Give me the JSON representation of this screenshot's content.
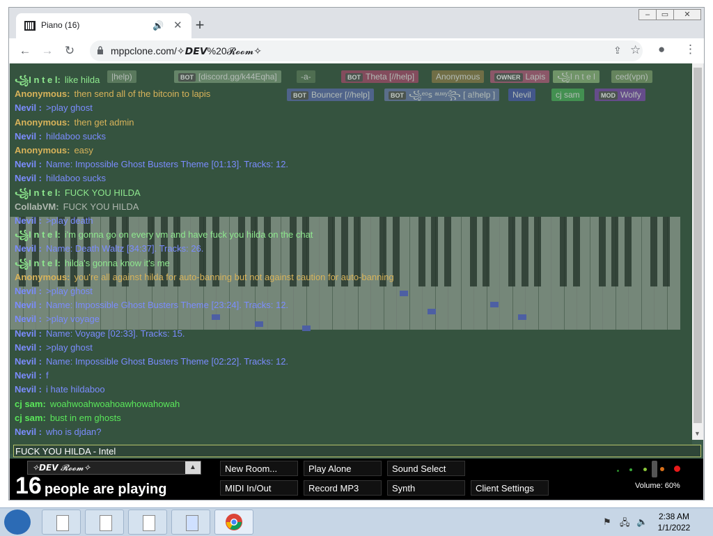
{
  "browser": {
    "tab_title": "Piano (16)",
    "new_tab_label": "+",
    "url": "mppclone.com/✧𝘿𝙀𝙑%20𝓡𝓸𝓸𝓶✧",
    "window_controls": [
      "minimize-icon",
      "maximize-icon",
      "close-icon"
    ]
  },
  "participants": [
    {
      "tag": "",
      "name": "|help)",
      "color": "#6b8a6b"
    },
    {
      "tag": "BOT",
      "name": "[discord.gg/k44Eqha]",
      "color": "#7a9a7a"
    },
    {
      "tag": "",
      "name": "-a-",
      "color": "#5a7a5a"
    },
    {
      "tag": "BOT",
      "name": "Theta [//help]",
      "color": "#a44a6a"
    },
    {
      "tag": "",
      "name": "Anonymous",
      "color": "#8a7a4a"
    },
    {
      "tag": "OWNER",
      "name": "Lapis",
      "color": "#b05a7a"
    },
    {
      "tag": "",
      "name": "꧁I n t e l",
      "color": "#8ab07a"
    },
    {
      "tag": "",
      "name": "ced(vpn)",
      "color": "#7a9a6a"
    },
    {
      "tag": "BOT",
      "name": "Bouncer [//help]",
      "color": "#5a6aaa"
    },
    {
      "tag": "BOT",
      "name": "꧁ᵉᵒꜱ ᵃᵘʷʸ꧂ [ a!help ]",
      "color": "#6a7aaa"
    },
    {
      "tag": "",
      "name": "Nevil",
      "color": "#4a5aaa"
    },
    {
      "tag": "",
      "name": "cj sam",
      "color": "#4aaa5a"
    },
    {
      "tag": "MOD",
      "name": "Wolfy",
      "color": "#7a4aaa"
    }
  ],
  "chat": {
    "messages": [
      {
        "who": "꧁I n t e l:",
        "text": "like hilda",
        "color": "#8ee88e"
      },
      {
        "who": "Anonymous:",
        "text": "then send all of the bitcoin to lapis",
        "color": "#d8b35a"
      },
      {
        "who": "Nevil :",
        "text": ">play ghost",
        "color": "#7b8cff"
      },
      {
        "who": "Anonymous:",
        "text": "then get admin",
        "color": "#d8b35a"
      },
      {
        "who": "Nevil :",
        "text": "hildaboo sucks",
        "color": "#7b8cff"
      },
      {
        "who": "Anonymous:",
        "text": "easy",
        "color": "#d8b35a"
      },
      {
        "who": "Nevil :",
        "text": "Name: Impossible Ghost Busters Theme [01:13]. Tracks: 12.",
        "color": "#7b8cff"
      },
      {
        "who": "Nevil :",
        "text": "hildaboo sucks",
        "color": "#7b8cff"
      },
      {
        "who": "꧁I n t e l:",
        "text": "FUCK YOU HILDA",
        "color": "#8ee88e"
      },
      {
        "who": "CollabVM:",
        "text": "FUCK YOU HILDA",
        "color": "#b0b8b0"
      },
      {
        "who": "Nevil :",
        "text": ">play death",
        "color": "#7b8cff"
      },
      {
        "who": "꧁I n t e l:",
        "text": "i'm gonna go on every vm and have fuck you hilda on the chat",
        "color": "#8ee88e"
      },
      {
        "who": "Nevil :",
        "text": "Name: Death Waltz [34:37]. Tracks: 26.",
        "color": "#7b8cff"
      },
      {
        "who": "꧁I n t e l:",
        "text": "hilda's gonna know it's me",
        "color": "#8ee88e"
      },
      {
        "who": "Anonymous:",
        "text": "you're all against hilda for auto-banning but not against caution for auto-banning",
        "color": "#d8b35a"
      },
      {
        "who": "Nevil :",
        "text": ">play ghost",
        "color": "#7b8cff"
      },
      {
        "who": "Nevil :",
        "text": "Name: Impossible Ghost Busters Theme [23:24]. Tracks: 12.",
        "color": "#7b8cff"
      },
      {
        "who": "Nevil :",
        "text": ">play voyage",
        "color": "#7b8cff"
      },
      {
        "who": "Nevil :",
        "text": "Name: Voyage [02:33]. Tracks: 15.",
        "color": "#7b8cff"
      },
      {
        "who": "Nevil :",
        "text": ">play ghost",
        "color": "#7b8cff"
      },
      {
        "who": "Nevil :",
        "text": "Name: Impossible Ghost Busters Theme [02:22]. Tracks: 12.",
        "color": "#7b8cff"
      },
      {
        "who": "Nevil :",
        "text": "f",
        "color": "#7b8cff"
      },
      {
        "who": "Nevil :",
        "text": "i hate hildaboo",
        "color": "#7b8cff"
      },
      {
        "who": "cj sam:",
        "text": "woahwoahwoahoawhowahowah",
        "color": "#5ae85a"
      },
      {
        "who": "cj sam:",
        "text": "bust in em ghosts",
        "color": "#5ae85a"
      },
      {
        "who": "Nevil :",
        "text": "who is djdan?",
        "color": "#7b8cff"
      }
    ],
    "input_value": "FUCK YOU HILDA - Intel"
  },
  "bottom": {
    "room_name": "✧𝘿𝙀𝙑 𝓡𝓸𝓸𝓶✧",
    "player_count": "16",
    "player_count_label": "people are playing",
    "buttons_row1": [
      "New Room...",
      "Play Alone",
      "Sound Select"
    ],
    "buttons_row2": [
      "MIDI In/Out",
      "Record MP3",
      "Synth",
      "Client Settings"
    ],
    "volume_label": "Volume: 60%"
  },
  "taskbar": {
    "time": "2:38 AM",
    "date": "1/1/2022"
  }
}
